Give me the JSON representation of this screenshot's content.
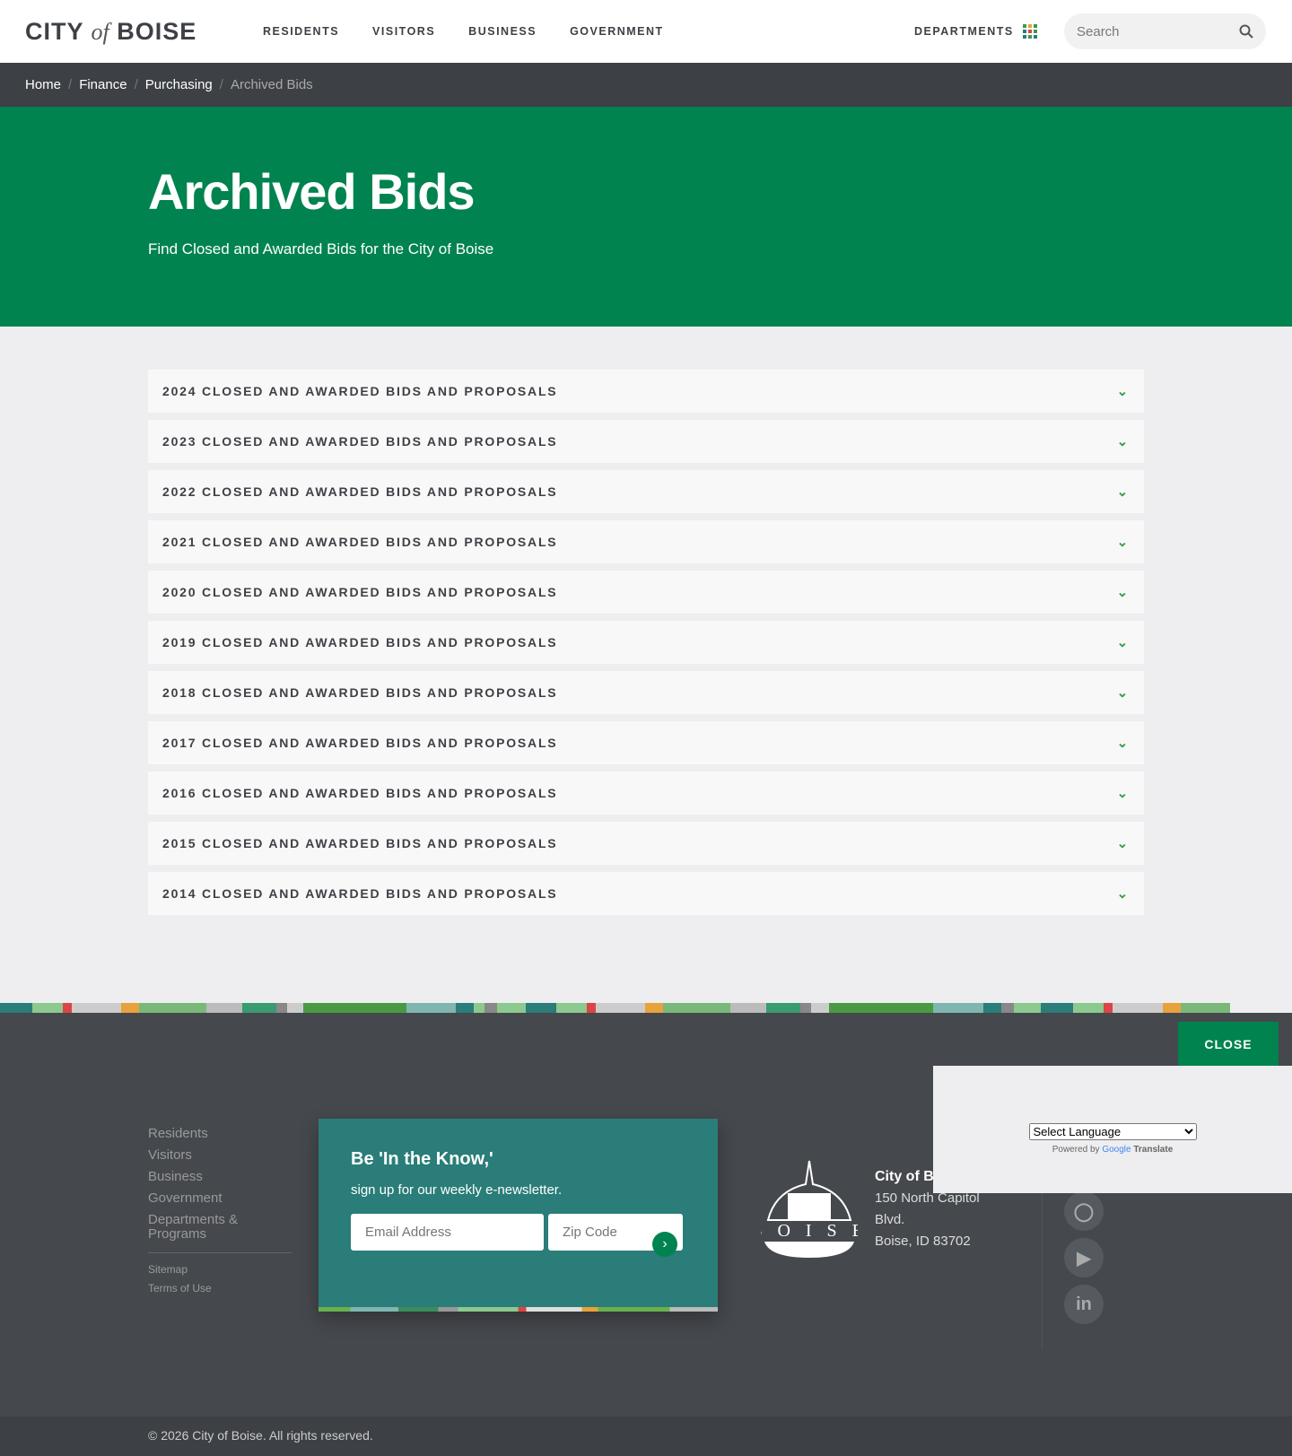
{
  "header": {
    "logo_city": "CITY",
    "logo_of": "of",
    "logo_boise": "BOISE",
    "nav": [
      "RESIDENTS",
      "VISITORS",
      "BUSINESS",
      "GOVERNMENT"
    ],
    "departments": "DEPARTMENTS",
    "search_placeholder": "Search"
  },
  "breadcrumb": [
    "Home",
    "Finance",
    "Purchasing",
    "Archived Bids"
  ],
  "hero": {
    "title": "Archived Bids",
    "subtitle": "Find Closed and Awarded Bids for the City of Boise"
  },
  "accordion": [
    "2024 CLOSED AND AWARDED BIDS AND PROPOSALS",
    "2023 CLOSED AND AWARDED BIDS AND PROPOSALS",
    "2022 CLOSED AND AWARDED BIDS AND PROPOSALS",
    "2021 CLOSED AND AWARDED BIDS AND PROPOSALS",
    "2020 CLOSED AND AWARDED BIDS AND PROPOSALS",
    "2019 CLOSED AND AWARDED BIDS AND PROPOSALS",
    "2018 CLOSED AND AWARDED BIDS AND PROPOSALS",
    "2017 CLOSED AND AWARDED BIDS AND PROPOSALS",
    "2016 CLOSED AND AWARDED BIDS AND PROPOSALS",
    "2015 CLOSED AND AWARDED BIDS AND PROPOSALS",
    "2014 CLOSED AND AWARDED BIDS AND PROPOSALS"
  ],
  "footer": {
    "links": [
      "Residents",
      "Visitors",
      "Business",
      "Government",
      "Departments & Programs"
    ],
    "small_links": [
      "Sitemap",
      "Terms of Use"
    ],
    "newsletter": {
      "title": "Be 'In the Know,'",
      "text": "sign up for our weekly e-newsletter.",
      "email_placeholder": "Email Address",
      "zip_placeholder": "Zip Code"
    },
    "seal_text": "BOISE",
    "address": {
      "name": "City of B",
      "line1": "150 North Capitol",
      "line2": "Blvd.",
      "line3": "Boise, ID 83702"
    },
    "copyright": "© 2026 City of Boise. All rights reserved."
  },
  "translate": {
    "close": "CLOSE",
    "select": "Select Language",
    "powered": "Powered by",
    "google": "Google",
    "translate": "Translate"
  },
  "colors": {
    "green": "#00834f",
    "dark": "#3d4045",
    "teal": "#2a7d78"
  }
}
